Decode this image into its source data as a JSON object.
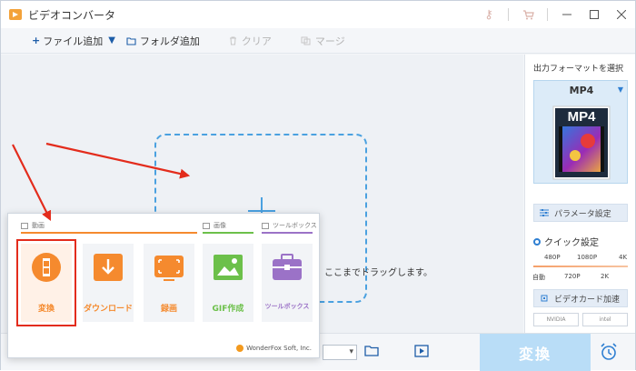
{
  "window": {
    "title": "ビデオコンバータ",
    "icons": [
      "key-icon",
      "cart-icon"
    ],
    "controls": [
      "minimize",
      "maximize",
      "close"
    ]
  },
  "toolbar": {
    "add_file": "ファイル追加",
    "add_folder": "フォルダ追加",
    "clear": "クリア",
    "merge": "マージ"
  },
  "main": {
    "drop_hint": "ここまでドラッグします。"
  },
  "output_panel": {
    "label": "出力フォーマットを選択",
    "format": "MP4",
    "format_image_text": "MP4",
    "params_button": "パラメータ設定",
    "quick_title": "クイック設定",
    "quick_top_labels": [
      "480P",
      "1080P",
      "4K"
    ],
    "quick_bottom_labels": [
      "自動",
      "720P",
      "2K"
    ],
    "gpu_button": "ビデオカード加速",
    "gpu_logos": [
      "NVIDIA",
      "intel"
    ]
  },
  "popup": {
    "categories": [
      "動画",
      "画像",
      "ツールボックス"
    ],
    "tiles": [
      {
        "label": "変換",
        "icon": "film-convert-icon",
        "color": "#f58a2e"
      },
      {
        "label": "ダウンロード",
        "icon": "download-icon",
        "color": "#f58a2e"
      },
      {
        "label": "録画",
        "icon": "screen-record-icon",
        "color": "#f58a2e"
      },
      {
        "label": "GIF作成",
        "icon": "image-gif-icon",
        "color": "#6cc04a"
      },
      {
        "label": "ツールボックス",
        "icon": "toolbox-icon",
        "color": "#9b72c7"
      }
    ],
    "brand": "WonderFox Soft, Inc."
  },
  "bottom": {
    "convert_button": "変換"
  },
  "colors": {
    "accent": "#2f7fd2",
    "video_orange": "#f58a2e",
    "image_green": "#6cc04a",
    "toolbox_purple": "#9b72c7",
    "highlight_red": "#e32c1c"
  }
}
